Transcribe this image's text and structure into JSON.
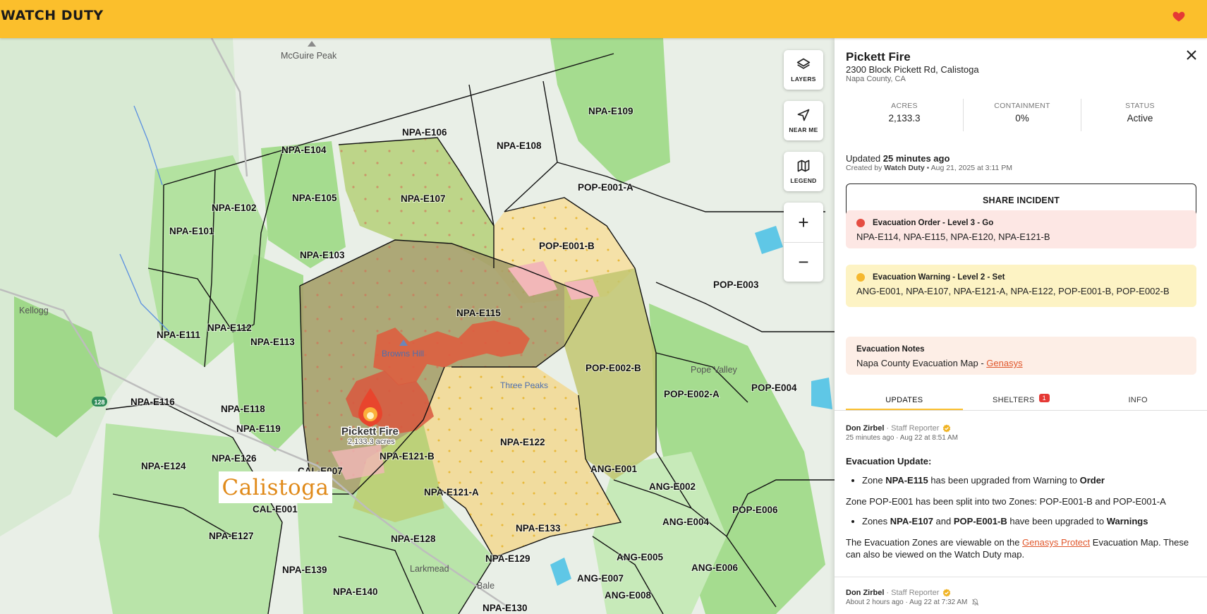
{
  "app": {
    "brand": "WATCH DUTY"
  },
  "map": {
    "city": "Calistoga",
    "fire": {
      "name": "Pickett Fire",
      "acres_label": "2,133.3 acres"
    },
    "zones": [
      "NPA-E104",
      "NPA-E106",
      "NPA-E108",
      "NPA-E109",
      "NPA-E105",
      "NPA-E107",
      "POP-E001-A",
      "NPA-E102",
      "NPA-E101",
      "NPA-E103",
      "POP-E001-B",
      "POP-E003",
      "NPA-E115",
      "NPA-E111",
      "NPA-E112",
      "NPA-E113",
      "POP-E002-B",
      "POP-E002-A",
      "POP-E004",
      "NPA-E116",
      "NPA-E118",
      "NPA-E119",
      "NPA-E122",
      "NPA-E124",
      "NPA-E126",
      "CAL-E007",
      "NPA-E121-B",
      "ANG-E001",
      "NPA-E121-A",
      "ANG-E002",
      "CAL-E001",
      "POP-E006",
      "ANG-E004",
      "NPA-E127",
      "NPA-E128",
      "NPA-E133",
      "NPA-E129",
      "ANG-E005",
      "ANG-E006",
      "NPA-E139",
      "ANG-E007",
      "NPA-E140",
      "ANG-E008",
      "NPA-E130"
    ],
    "places": [
      "McGuire Peak",
      "Kellogg",
      "Browns Hill",
      "Three Peaks",
      "Pope Valley",
      "Larkmead",
      "Bale"
    ],
    "road_shield": "128",
    "controls": {
      "layers": "LAYERS",
      "near_me": "NEAR ME",
      "legend": "LEGEND",
      "zoom_in": "+",
      "zoom_out": "−"
    }
  },
  "incident": {
    "title": "Pickett Fire",
    "address": "2300 Block Pickett Rd, Calistoga",
    "county": "Napa County, CA",
    "stats": [
      {
        "label": "ACRES",
        "value": "2,133.3"
      },
      {
        "label": "CONTAINMENT",
        "value": "0%"
      },
      {
        "label": "STATUS",
        "value": "Active"
      }
    ],
    "updated_prefix": "Updated",
    "updated_value": "25 minutes ago",
    "created_prefix": "Created by",
    "created_by": "Watch Duty",
    "created_suffix": "• Aug 21, 2025 at 3:11 PM",
    "share_label": "SHARE INCIDENT",
    "order": {
      "title": "Evacuation Order - Level 3 - Go",
      "zones": "NPA-E114, NPA-E115, NPA-E120, NPA-E121-B",
      "color": "#e54d42"
    },
    "warning": {
      "title": "Evacuation Warning - Level 2 - Set",
      "zones": "ANG-E001, NPA-E107, NPA-E121-A, NPA-E122, POP-E001-B, POP-E002-B",
      "color": "#f5b82e"
    },
    "notes": {
      "title": "Evacuation Notes",
      "text": "Napa County Evacuation Map - ",
      "link": "Genasys"
    },
    "tabs": [
      {
        "label": "UPDATES"
      },
      {
        "label": "SHELTERS",
        "badge": "1"
      },
      {
        "label": "INFO"
      }
    ],
    "posts": [
      {
        "author": "Don Zirbel",
        "role": "· Staff Reporter",
        "time": "25 minutes ago · Aug 22 at 8:51 AM",
        "heading": "Evacuation Update:",
        "b1_pre": "Zone ",
        "b1_zone": "NPA-E115",
        "b1_mid": " has been upgraded from Warning to ",
        "b1_end": "Order",
        "para1": "Zone POP-E001 has been split into two Zones: POP-E001-B and POP-E001-A",
        "b2_pre": "Zones ",
        "b2_z1": "NPA-E107",
        "b2_and": " and ",
        "b2_z2": "POP-E001-B",
        "b2_mid": " have been upgraded to ",
        "b2_end": "Warnings",
        "para2_pre": "The Evacuation Zones are viewable on the ",
        "para2_link": "Genasys Protect",
        "para2_post": " Evacuation Map. These can also be viewed on the Watch Duty map."
      },
      {
        "author": "Don Zirbel",
        "role": "· Staff Reporter",
        "time": "About 2 hours ago · Aug 22 at 7:32 AM"
      }
    ]
  },
  "colors": {
    "brand": "#fbbf2c",
    "order_bg": "#fde7e4",
    "warning_bg": "#fdf3c4",
    "notes_bg": "#fdeee6",
    "link": "#e0562b"
  }
}
